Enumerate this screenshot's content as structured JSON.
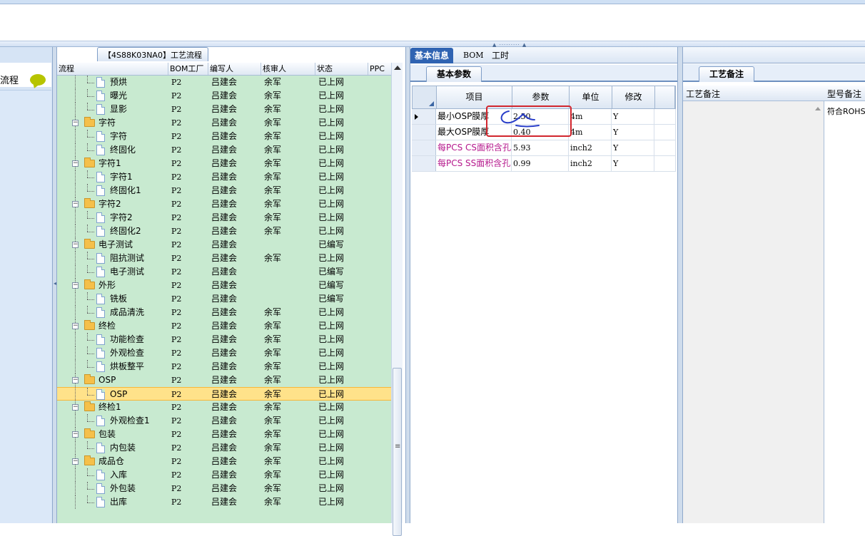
{
  "left_nav": {
    "label": "流程"
  },
  "tree_panel": {
    "title": "【4S88K03NA0】工艺流程",
    "headers": [
      "流程",
      "BOM工厂",
      "编写人",
      "核审人",
      "状态",
      "PPC"
    ]
  },
  "tree_rows": [
    {
      "name": "预烘",
      "level": 2,
      "type": "doc",
      "bom": "P2",
      "writer": "吕建会",
      "checker": "余军",
      "status": "已上网"
    },
    {
      "name": "曝光",
      "level": 2,
      "type": "doc",
      "bom": "P2",
      "writer": "吕建会",
      "checker": "余军",
      "status": "已上网"
    },
    {
      "name": "显影",
      "level": 2,
      "type": "doc",
      "bom": "P2",
      "writer": "吕建会",
      "checker": "余军",
      "status": "已上网"
    },
    {
      "name": "字符",
      "level": 1,
      "type": "folder",
      "bom": "P2",
      "writer": "吕建会",
      "checker": "余军",
      "status": "已上网"
    },
    {
      "name": "字符",
      "level": 2,
      "type": "doc",
      "bom": "P2",
      "writer": "吕建会",
      "checker": "余军",
      "status": "已上网"
    },
    {
      "name": "终固化",
      "level": 2,
      "type": "doc",
      "bom": "P2",
      "writer": "吕建会",
      "checker": "余军",
      "status": "已上网"
    },
    {
      "name": "字符1",
      "level": 1,
      "type": "folder",
      "bom": "P2",
      "writer": "吕建会",
      "checker": "余军",
      "status": "已上网"
    },
    {
      "name": "字符1",
      "level": 2,
      "type": "doc",
      "bom": "P2",
      "writer": "吕建会",
      "checker": "余军",
      "status": "已上网"
    },
    {
      "name": "终固化1",
      "level": 2,
      "type": "doc",
      "bom": "P2",
      "writer": "吕建会",
      "checker": "余军",
      "status": "已上网"
    },
    {
      "name": "字符2",
      "level": 1,
      "type": "folder",
      "bom": "P2",
      "writer": "吕建会",
      "checker": "余军",
      "status": "已上网"
    },
    {
      "name": "字符2",
      "level": 2,
      "type": "doc",
      "bom": "P2",
      "writer": "吕建会",
      "checker": "余军",
      "status": "已上网"
    },
    {
      "name": "终固化2",
      "level": 2,
      "type": "doc",
      "bom": "P2",
      "writer": "吕建会",
      "checker": "余军",
      "status": "已上网"
    },
    {
      "name": "电子测试",
      "level": 1,
      "type": "folder",
      "bom": "P2",
      "writer": "吕建会",
      "checker": "",
      "status": "已编写"
    },
    {
      "name": "阻抗测试",
      "level": 2,
      "type": "doc",
      "bom": "P2",
      "writer": "吕建会",
      "checker": "余军",
      "status": "已上网"
    },
    {
      "name": "电子测试",
      "level": 2,
      "type": "doc",
      "bom": "P2",
      "writer": "吕建会",
      "checker": "",
      "status": "已编写"
    },
    {
      "name": "外形",
      "level": 1,
      "type": "folder",
      "bom": "P2",
      "writer": "吕建会",
      "checker": "",
      "status": "已编写"
    },
    {
      "name": "铣板",
      "level": 2,
      "type": "doc",
      "bom": "P2",
      "writer": "吕建会",
      "checker": "",
      "status": "已编写"
    },
    {
      "name": "成品清洗",
      "level": 2,
      "type": "doc",
      "bom": "P2",
      "writer": "吕建会",
      "checker": "余军",
      "status": "已上网"
    },
    {
      "name": "终检",
      "level": 1,
      "type": "folder",
      "bom": "P2",
      "writer": "吕建会",
      "checker": "余军",
      "status": "已上网"
    },
    {
      "name": "功能检查",
      "level": 2,
      "type": "doc",
      "bom": "P2",
      "writer": "吕建会",
      "checker": "余军",
      "status": "已上网"
    },
    {
      "name": "外观检查",
      "level": 2,
      "type": "doc",
      "bom": "P2",
      "writer": "吕建会",
      "checker": "余军",
      "status": "已上网"
    },
    {
      "name": "烘板整平",
      "level": 2,
      "type": "doc",
      "bom": "P2",
      "writer": "吕建会",
      "checker": "余军",
      "status": "已上网"
    },
    {
      "name": "OSP",
      "level": 1,
      "type": "folder",
      "bom": "P2",
      "writer": "吕建会",
      "checker": "余军",
      "status": "已上网"
    },
    {
      "name": "OSP",
      "level": 2,
      "type": "doc",
      "bom": "P2",
      "writer": "吕建会",
      "checker": "余军",
      "status": "已上网",
      "selected": true
    },
    {
      "name": "终检1",
      "level": 1,
      "type": "folder",
      "bom": "P2",
      "writer": "吕建会",
      "checker": "余军",
      "status": "已上网"
    },
    {
      "name": "外观检查1",
      "level": 2,
      "type": "doc",
      "bom": "P2",
      "writer": "吕建会",
      "checker": "余军",
      "status": "已上网"
    },
    {
      "name": "包装",
      "level": 1,
      "type": "folder",
      "bom": "P2",
      "writer": "吕建会",
      "checker": "余军",
      "status": "已上网"
    },
    {
      "name": "内包装",
      "level": 2,
      "type": "doc",
      "bom": "P2",
      "writer": "吕建会",
      "checker": "余军",
      "status": "已上网"
    },
    {
      "name": "成品仓",
      "level": 1,
      "type": "folder",
      "bom": "P2",
      "writer": "吕建会",
      "checker": "余军",
      "status": "已上网"
    },
    {
      "name": "入库",
      "level": 2,
      "type": "doc",
      "bom": "P2",
      "writer": "吕建会",
      "checker": "余军",
      "status": "已上网"
    },
    {
      "name": "外包装",
      "level": 2,
      "type": "doc",
      "bom": "P2",
      "writer": "吕建会",
      "checker": "余军",
      "status": "已上网"
    },
    {
      "name": "出库",
      "level": 2,
      "type": "doc",
      "bom": "P2",
      "writer": "吕建会",
      "checker": "余军",
      "status": "已上网"
    }
  ],
  "tabs": [
    "基本信息",
    "BOM",
    "工时"
  ],
  "params_panel": {
    "subtab": "基本参数",
    "headers": [
      "项目",
      "参数",
      "单位",
      "修改"
    ],
    "rows": [
      {
        "item": "最小OSP膜厚",
        "value": "2.50",
        "unit": "4m",
        "modify": "Y",
        "pink": false,
        "current": true
      },
      {
        "item": "最大OSP膜厚",
        "value": "0.40",
        "unit": "4m",
        "modify": "Y",
        "pink": false,
        "current": false
      },
      {
        "item": "每PCS CS面积含孔",
        "value": "5.93",
        "unit": "inch2",
        "modify": "Y",
        "pink": true,
        "current": false
      },
      {
        "item": "每PCS SS面积含孔",
        "value": "0.99",
        "unit": "inch2",
        "modify": "Y",
        "pink": true,
        "current": false
      }
    ]
  },
  "memo_panel": {
    "tab": "工艺备注",
    "col1": "工艺备注",
    "col2": "型号备注",
    "value": "符合ROHS"
  },
  "colors": {
    "tree_bg": "#c8ead0",
    "selected_row": "#ffe28a",
    "active_tab": "#2f63b2",
    "annotation_red": "#d2252d",
    "pink_text": "#b5178c"
  }
}
